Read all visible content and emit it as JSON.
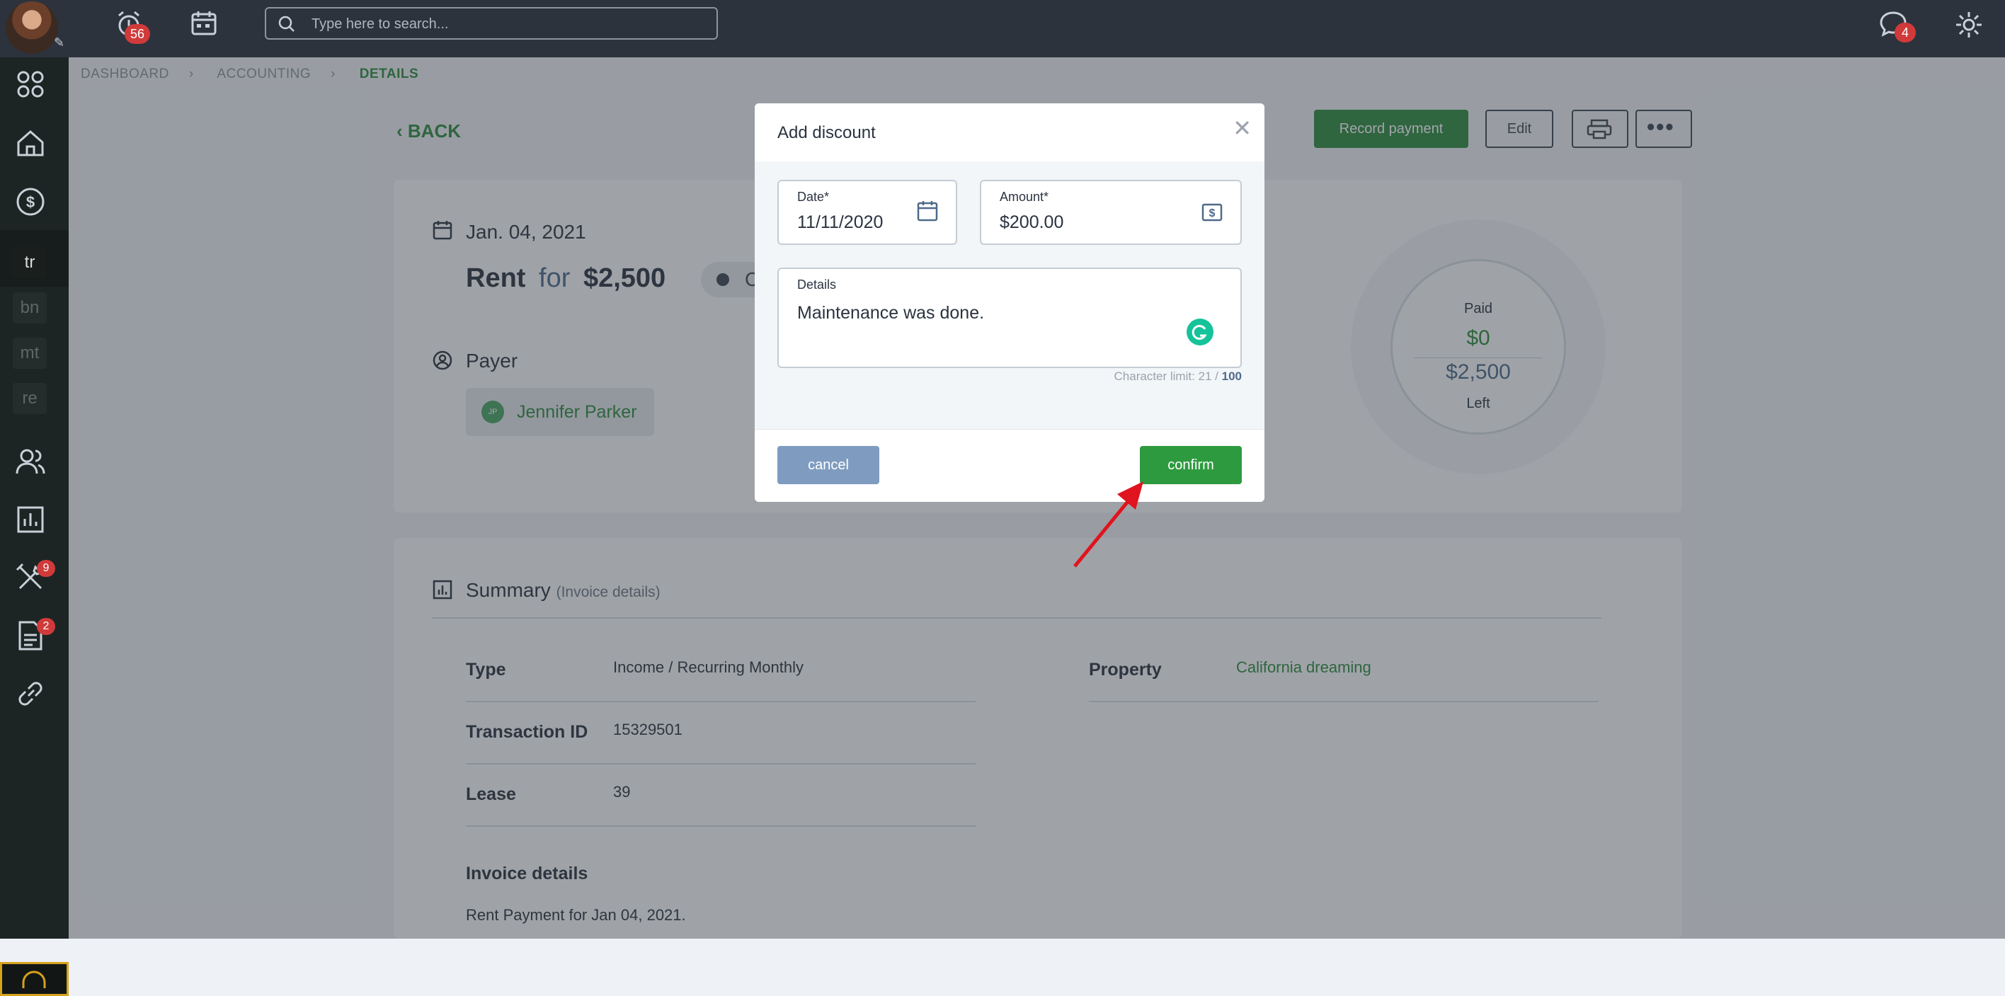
{
  "topbar": {
    "notifications_count": "56",
    "messages_count": "4",
    "search_placeholder": "Type here to search..."
  },
  "sidebar": {
    "boxes": [
      "tr",
      "bn",
      "mt",
      "re"
    ],
    "tools_badge": "9",
    "docs_badge": "2"
  },
  "breadcrumb": [
    "DASHBOARD",
    "ACCOUNTING",
    "DETAILS"
  ],
  "page": {
    "back_label": "BACK",
    "record_payment_label": "Record payment",
    "edit_label": "Edit",
    "date": "Jan. 04, 2021",
    "title_type": "Rent",
    "title_for": "for",
    "title_amount": "$2,500",
    "status_partial": "C",
    "payer_heading": "Payer",
    "payer_initials": "JP",
    "payer_name": "Jennifer Parker",
    "paid_label": "Paid",
    "paid_value": "$0",
    "left_value": "$2,500",
    "left_label": "Left"
  },
  "summary": {
    "heading": "Summary",
    "subheading": "(Invoice details)",
    "rows_left": [
      {
        "label": "Type",
        "value": "Income / Recurring Monthly"
      },
      {
        "label": "Transaction ID",
        "value": "15329501"
      },
      {
        "label": "Lease",
        "value": "39"
      }
    ],
    "property_label": "Property",
    "property_value": "California dreaming",
    "invoice_heading": "Invoice details",
    "invoice_text": "Rent Payment for Jan 04, 2021."
  },
  "modal": {
    "title": "Add discount",
    "date_label": "Date*",
    "date_value": "11/11/2020",
    "amount_label": "Amount*",
    "amount_value": "$200.00",
    "details_label": "Details",
    "details_value": "Maintenance was done.",
    "char_limit_prefix": "Character limit: 21 / ",
    "char_limit_max": "100",
    "cancel_label": "cancel",
    "confirm_label": "confirm"
  },
  "colors": {
    "accent_green": "#2e8a3f",
    "confirm_green": "#2e9a3f",
    "cancel_blue": "#7f9cc0",
    "badge_red": "#d13a3a",
    "arrow_red": "#e0141e"
  }
}
